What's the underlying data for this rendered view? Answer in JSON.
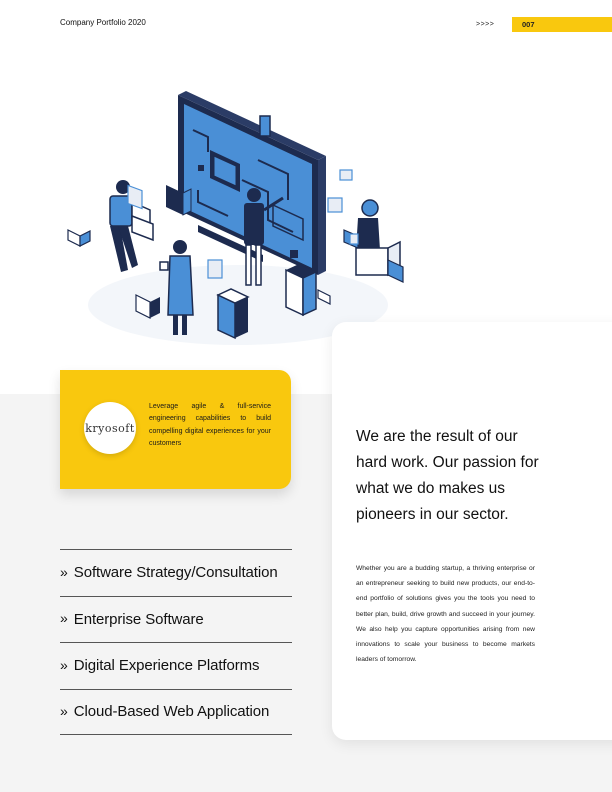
{
  "header": {
    "title": "Company Portfolio 2020",
    "arrows": ">>>>",
    "page_number": "007"
  },
  "illustration": {
    "description_icon": "isometric-team-engineering-icon"
  },
  "card": {
    "logo_text": "kryosoft",
    "text": "Leverage agile & full-service engineering capabilities to build compelling digital experiences for your customers"
  },
  "services": [
    {
      "arrow": "»",
      "label": "Software Strategy/Consultation"
    },
    {
      "arrow": "»",
      "label": "Enterprise Software"
    },
    {
      "arrow": "»",
      "label": "Digital Experience Platforms"
    },
    {
      "arrow": "»",
      "label": "Cloud-Based Web Application"
    }
  ],
  "main": {
    "headline": "We are the result of our hard work. Our passion for what we do makes us pioneers in our sector.",
    "body": "Whether you are a budding startup, a thriving enterprise or an entrepreneur seeking to build new products, our end-to-end portfolio of solutions gives you the tools you need to better plan, build, drive growth and succeed in your journey. We also help you capture opportunities arising from new innovations to scale your business to become markets leaders of tomorrow."
  },
  "colors": {
    "accent": "#f9c80e",
    "illustration_blue": "#4a8fd6",
    "illustration_dark": "#1d2b4f"
  }
}
